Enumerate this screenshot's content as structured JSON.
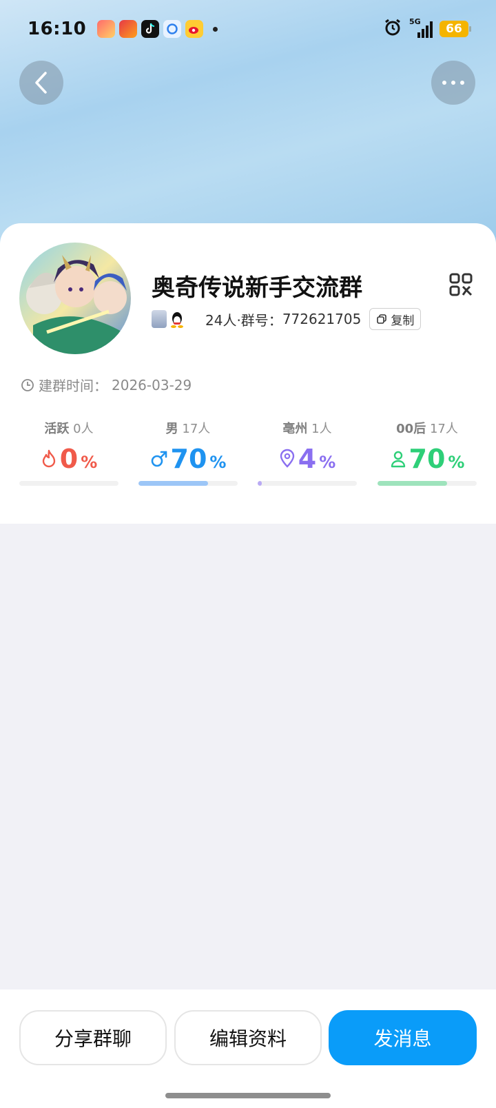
{
  "status_bar": {
    "time": "16:10",
    "battery": "66",
    "network": "5G",
    "notification_apps": [
      "app-icon-1",
      "app-icon-2",
      "tiktok-icon",
      "browser-icon",
      "weibo-icon"
    ]
  },
  "group": {
    "name": "奥奇传说新手交流群",
    "member_count": "24人",
    "id_label": "·群号：",
    "id": "772621705",
    "copy_label": "复制",
    "created_label": "建群时间：",
    "created_date": "2026-03-29"
  },
  "stats": [
    {
      "label": "活跃",
      "count": "0人",
      "value": "0",
      "unit": "%",
      "icon": "flame-icon",
      "color": "#f05a4a",
      "bar_color": "#f3c2bc",
      "fraction": 0.0
    },
    {
      "label": "男",
      "count": "17人",
      "value": "70",
      "unit": "%",
      "icon": "male-icon",
      "color": "#1f93f0",
      "bar_color": "#9cc6f7",
      "fraction": 0.7
    },
    {
      "label": "亳州",
      "count": "1人",
      "value": "4",
      "unit": "%",
      "icon": "location-icon",
      "color": "#8a6ff0",
      "bar_color": "#b9aaf4",
      "fraction": 0.04
    },
    {
      "label": "00后",
      "count": "17人",
      "value": "70",
      "unit": "%",
      "icon": "person-icon",
      "color": "#2ecf78",
      "bar_color": "#9ee3bc",
      "fraction": 0.7
    }
  ],
  "actions": {
    "share": "分享群聊",
    "edit": "编辑资料",
    "message": "发消息"
  },
  "colors": {
    "primary": "#0a9cf9",
    "page_background": "#f1f1f6"
  }
}
